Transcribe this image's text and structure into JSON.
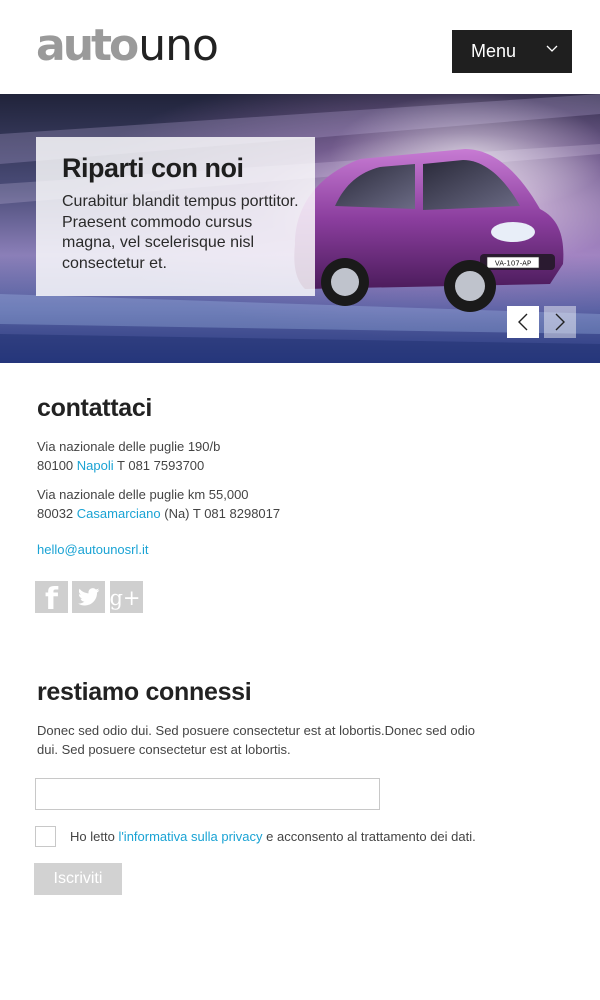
{
  "header": {
    "logo_part1": "auto",
    "logo_part2": "uno",
    "menu_label": "Menu"
  },
  "hero": {
    "title": "Riparti con noi",
    "text": "Curabitur blandit tempus porttitor. Praesent commodo cursus magna, vel scelerisque nisl consectetur et.",
    "plate": "VA-107-AP"
  },
  "contact": {
    "title": "contattaci",
    "address1_line1": "Via nazionale delle puglie 190/b",
    "address1_zip": "80100",
    "address1_city": "Napoli",
    "address1_phone": "T 081 7593700",
    "address2_line1": "Via nazionale delle puglie km 55,000",
    "address2_zip": "80032",
    "address2_city": "Casamarciano",
    "address2_prov": "(Na) T 081 8298017",
    "email": "hello@autounosrl.it"
  },
  "social": {
    "facebook_glyph": "f",
    "googleplus_glyph": "g+"
  },
  "newsletter": {
    "title": "restiamo connessi",
    "text": "Donec sed odio dui. Sed posuere consectetur est at lobortis.Donec sed odio dui. Sed posuere consectetur est at lobortis.",
    "input_value": "",
    "privacy_prefix": "Ho letto",
    "privacy_link": "l'informativa sulla privacy",
    "privacy_suffix": "e acconsento al trattamento dei dati.",
    "submit_label": "Iscriviti"
  },
  "colors": {
    "link": "#1aa3d4",
    "menu_bg": "#1f1f1f",
    "social_bg": "#cfcfcf",
    "button_bg": "#d2d2d2"
  },
  "icons": [
    "chevron-down-icon",
    "arrow-left-icon",
    "arrow-right-icon",
    "facebook-icon",
    "twitter-icon",
    "googleplus-icon"
  ]
}
